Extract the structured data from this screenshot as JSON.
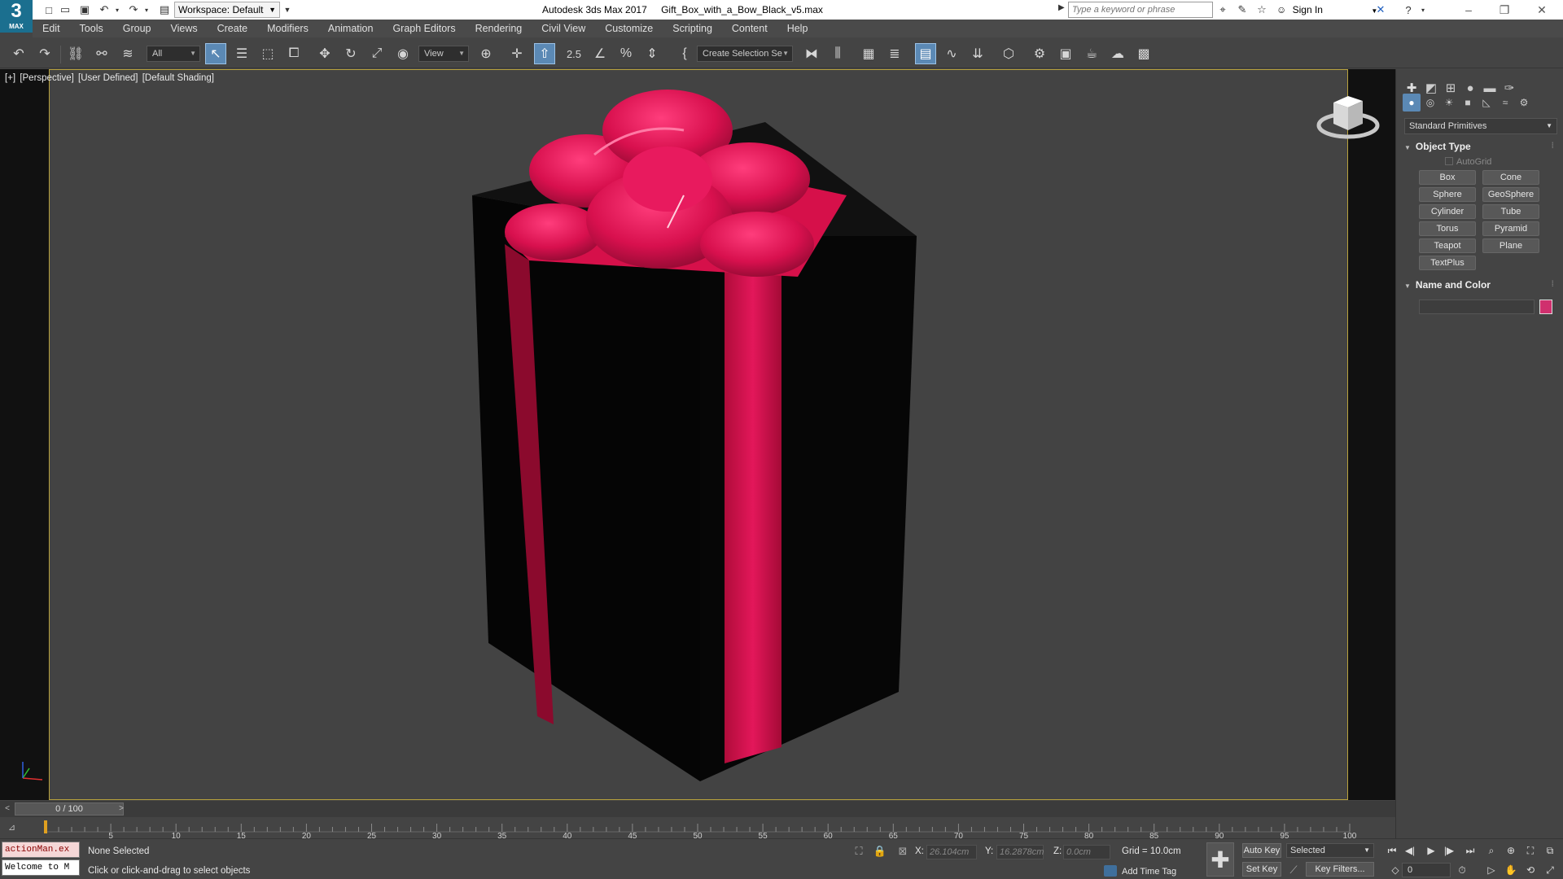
{
  "app": {
    "logo_number": "3",
    "logo_text": "MAX",
    "title": "Autodesk 3ds Max 2017",
    "file": "Gift_Box_with_a_Bow_Black_v5.max",
    "workspace": "Workspace: Default",
    "search_placeholder": "Type a keyword or phrase",
    "sign_in": "Sign In"
  },
  "menu": [
    "Edit",
    "Tools",
    "Group",
    "Views",
    "Create",
    "Modifiers",
    "Animation",
    "Graph Editors",
    "Rendering",
    "Civil View",
    "Customize",
    "Scripting",
    "Content",
    "Help"
  ],
  "toolbar": {
    "selection_filter": "All",
    "reference_coord": "View",
    "named_selection": "Create Selection Se",
    "snap_label": "2.5"
  },
  "viewport": {
    "label_plus": "[+]",
    "label_view": "[Perspective]",
    "label_mode": "[User Defined]",
    "label_shading": "[Default Shading]",
    "box_color": "#050505",
    "ribbon_color": "#d6104a"
  },
  "command_panel": {
    "category": "Standard Primitives",
    "object_type_title": "Object Type",
    "autogrid": "AutoGrid",
    "buttons": [
      "Box",
      "Cone",
      "Sphere",
      "GeoSphere",
      "Cylinder",
      "Tube",
      "Torus",
      "Pyramid",
      "Teapot",
      "Plane",
      "TextPlus"
    ],
    "name_color_title": "Name and Color",
    "name_value": "",
    "swatch_color": "#d0306e"
  },
  "timeline": {
    "slider_text": "0 / 100",
    "prev": "<",
    "next": ">",
    "ticks": [
      "5",
      "10",
      "15",
      "20",
      "25",
      "30",
      "35",
      "40",
      "45",
      "50",
      "55",
      "60",
      "65",
      "70",
      "75",
      "80",
      "85",
      "90",
      "95",
      "100"
    ]
  },
  "status": {
    "maxscript_line1": "actionMan.ex",
    "maxscript_line2": "Welcome to M",
    "selection": "None Selected",
    "prompt": "Click or click-and-drag to select objects",
    "x_label": "X:",
    "x_value": "26.104cm",
    "y_label": "Y:",
    "y_value": "16.2878cm",
    "z_label": "Z:",
    "z_value": "0.0cm",
    "grid": "Grid = 10.0cm",
    "add_time_tag": "Add Time Tag",
    "auto_key": "Auto Key",
    "set_key": "Set Key",
    "selected": "Selected",
    "key_filters": "Key Filters...",
    "frame": "0"
  }
}
